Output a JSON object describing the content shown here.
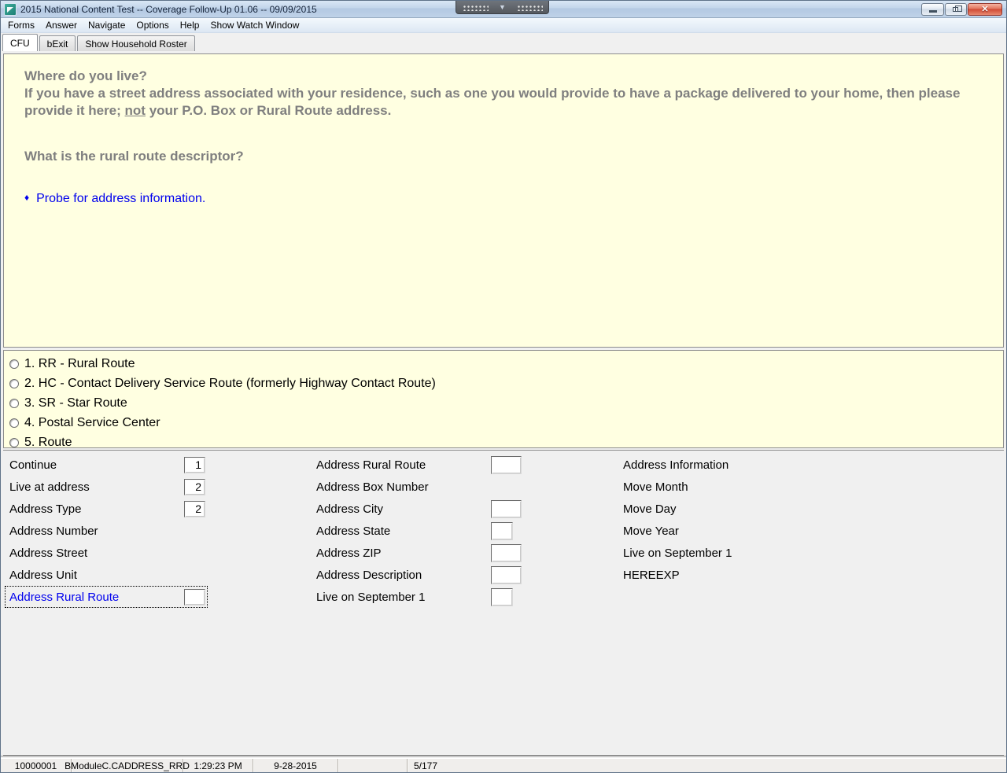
{
  "window": {
    "title": "2015 National Content Test -- Coverage Follow-Up 01.06 -- 09/09/2015",
    "controls": {
      "minimize": "minimize",
      "restore": "restore",
      "close": "✕"
    }
  },
  "menu": {
    "items": [
      "Forms",
      "Answer",
      "Navigate",
      "Options",
      "Help",
      "Show Watch Window"
    ]
  },
  "tabs": [
    {
      "label": "CFU",
      "active": true
    },
    {
      "label": "bExit",
      "active": false
    },
    {
      "label": "Show Household Roster",
      "active": false
    }
  ],
  "question": {
    "line1": "Where do you live?",
    "para_pre": "If you have a street address associated with your residence, such as one you would provide to have a package delivered to your home, then please provide it here; ",
    "para_underline": "not",
    "para_post": " your P.O. Box or Rural Route address.",
    "followup": "What is the rural route descriptor?",
    "probe_bullet": "♦",
    "probe": "Probe for address information."
  },
  "options": [
    "1. RR - Rural Route",
    "2. HC - Contact Delivery Service Route (formerly Highway Contact Route)",
    "3. SR - Star Route",
    "4. Postal Service Center",
    "5. Route"
  ],
  "form": {
    "col1": [
      {
        "label": "Continue",
        "value": "1"
      },
      {
        "label": "Live at address",
        "value": "2"
      },
      {
        "label": "Address Type",
        "value": "2"
      },
      {
        "label": "Address Number"
      },
      {
        "label": "Address Street"
      },
      {
        "label": "Address Unit"
      },
      {
        "label": "Address Rural Route",
        "value": "",
        "focused": true
      }
    ],
    "col2": [
      {
        "label": "Address Rural Route"
      },
      {
        "label": "Address Box Number"
      },
      {
        "label": "Address City"
      },
      {
        "label": "Address State"
      },
      {
        "label": "Address ZIP"
      },
      {
        "label": "Address Description"
      },
      {
        "label": "Live on September 1"
      }
    ],
    "col3": [
      {
        "label": "Address Information"
      },
      {
        "label": "Move Month"
      },
      {
        "label": "Move Day"
      },
      {
        "label": "Move Year"
      },
      {
        "label": "Live on September 1"
      },
      {
        "label": "HEREEXP"
      }
    ]
  },
  "statusbar": {
    "cells": [
      "10000001",
      "BModuleC.CADDRESS_RRD",
      "1:29:23 PM",
      "9-28-2015",
      "",
      "5/177"
    ]
  },
  "colors": {
    "question_bg": "#ffffe1",
    "question_text": "#7f7f7f",
    "link_blue": "#0000ee",
    "titlebar_blue": "#c2d5ea",
    "close_red": "#cf4530"
  }
}
